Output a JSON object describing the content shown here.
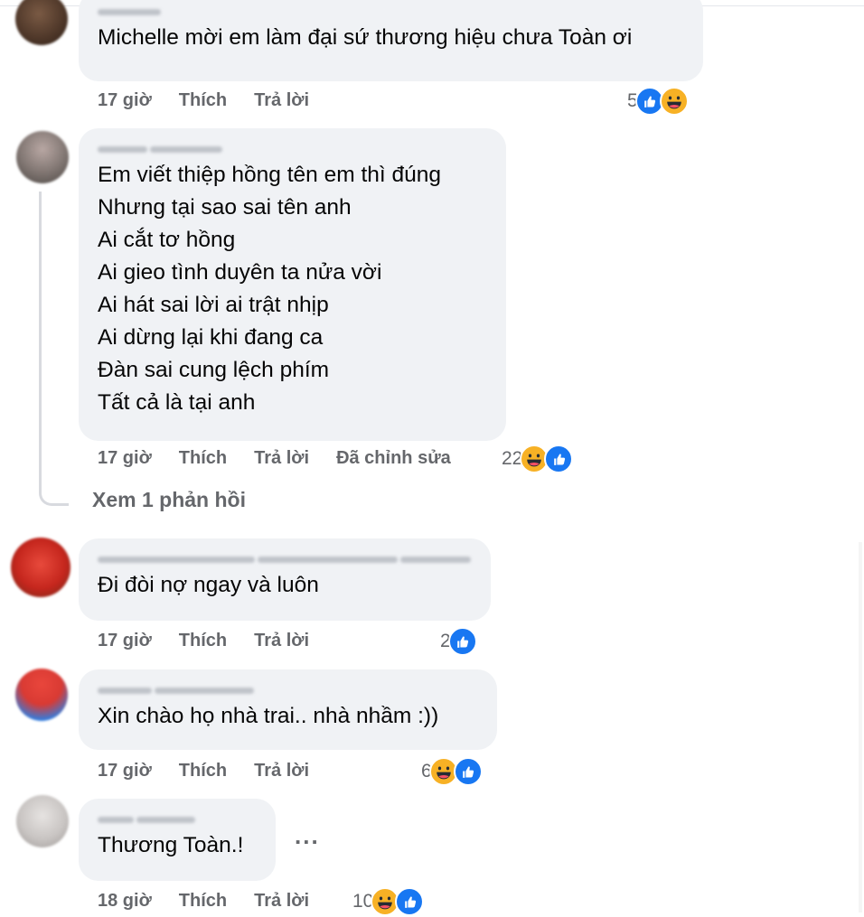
{
  "comments": [
    {
      "text": "Michelle mời em làm đại sứ thương hiệu chưa Toàn ơi",
      "time": "17 giờ",
      "like_label": "Thích",
      "reply_label": "Trả lời",
      "reaction_count": "5",
      "reactions": [
        "like-icon",
        "haha-icon"
      ]
    },
    {
      "text": "Em viết thiệp hồng tên em thì đúng\nNhưng tại sao sai tên anh\nAi cắt tơ hồng\nAi gieo tình duyên ta nửa vời\nAi hát sai lời ai trật nhịp\nAi dừng lại khi đang ca\nĐàn sai cung lệch phím\nTất cả là tại anh",
      "time": "17 giờ",
      "like_label": "Thích",
      "reply_label": "Trả lời",
      "edited_label": "Đã chỉnh sửa",
      "reaction_count": "22",
      "reactions": [
        "haha-icon",
        "like-icon"
      ],
      "view_replies": "Xem 1 phản hồi"
    },
    {
      "text": "Đi đòi nợ ngay và luôn",
      "time": "17 giờ",
      "like_label": "Thích",
      "reply_label": "Trả lời",
      "reaction_count": "2",
      "reactions": [
        "like-icon"
      ]
    },
    {
      "text": "Xin chào họ nhà trai.. nhà nhầm :))",
      "time": "17 giờ",
      "like_label": "Thích",
      "reply_label": "Trả lời",
      "reaction_count": "6",
      "reactions": [
        "haha-icon",
        "like-icon"
      ]
    },
    {
      "text": "Thương Toàn.!",
      "time": "18 giờ",
      "like_label": "Thích",
      "reply_label": "Trả lời",
      "reaction_count": "10",
      "reactions": [
        "haha-icon",
        "like-icon"
      ],
      "more_label": "..."
    }
  ],
  "colors": {
    "bubble": "#f0f2f5",
    "meta": "#65676b",
    "like": "#1877f2",
    "haha": "#f7b125"
  }
}
